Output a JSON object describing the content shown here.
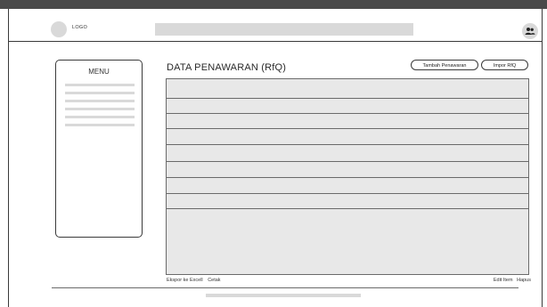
{
  "header": {
    "logo_label": "LOGO",
    "user_icon": "users-icon"
  },
  "menu": {
    "title": "MENU",
    "items_count_placeholder": 6
  },
  "main": {
    "title": "DATA PENAWARAN (RfQ)",
    "buttons": {
      "add": "Tambah Penawaran",
      "import": "Impor RfQ"
    },
    "table": {
      "rows": 8
    },
    "footer_left": {
      "export": "Ekspor ke Excell",
      "print": "Cetak"
    },
    "footer_right": {
      "edit": "Edit Item",
      "delete": "Hapus"
    }
  },
  "colors": {
    "placeholder": "#d9d9d9",
    "frame": "#4a4a4a",
    "table_bg": "#e8e8e8"
  }
}
